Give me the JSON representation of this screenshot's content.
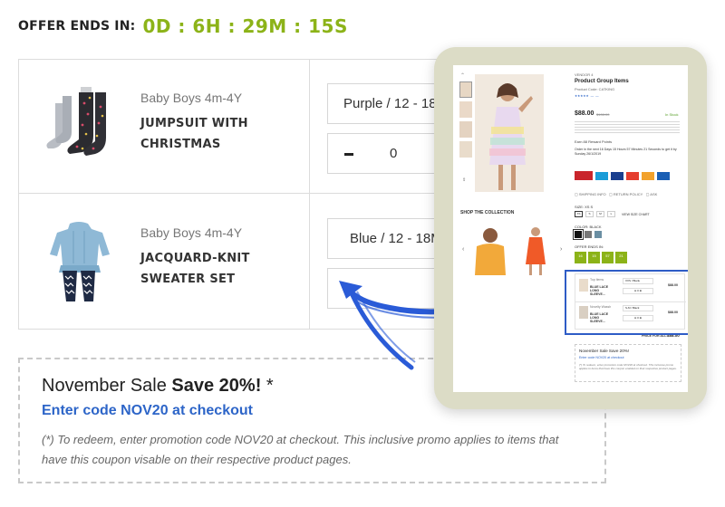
{
  "offer": {
    "label": "OFFER ENDS IN:",
    "timer": "0D : 6H : 29M : 15S"
  },
  "products": [
    {
      "category": "Baby Boys 4m-4Y",
      "title": "JUMPSUIT WITH\nCHRISTMAS",
      "variant": "Purple / 12 - 18",
      "quantity": "0"
    },
    {
      "category": "Baby Boys 4m-4Y",
      "title": "JACQUARD-KNIT\nSWEATER SET",
      "variant": "Blue / 12 - 18M",
      "quantity": ""
    }
  ],
  "sale": {
    "heading_plain": "November Sale ",
    "heading_bold": "Save 20%!",
    "heading_suffix": " *",
    "code_text": "Enter code NOV20 at checkout",
    "note": "(*) To redeem, enter promotion code NOV20 at checkout. This inclusive promo applies to items that have this coupon visable on their respective product pages."
  },
  "preview": {
    "vendor": "VENDOR 4",
    "title": "Product Group Items",
    "product_code": "Product Code: CATKING",
    "price": "$88.00",
    "old_price": "$108.00",
    "stock": "In Stock",
    "add_rewards": "Earn 88 Reward Points",
    "order_note": "Order in the next 16 Days 15 Hours 57 Minutes 21 Seconds to get it by Sunday 26/1/2019",
    "shop_collection": "SHOP THE COLLECTION",
    "size_label": "SIZE: XS S",
    "sizes": [
      "XS",
      "S",
      "M",
      "L"
    ],
    "size_chart": "VIEW SIZE CHART",
    "color_label": "COLOR: BLACK",
    "offer_label": "OFFER ENDS IN:",
    "offer_boxes": [
      "16",
      "15",
      "57",
      "21"
    ],
    "mini_items": [
      {
        "tag": "Top Items",
        "name": "BLUE LACE LONG SLEEVE...",
        "variant": "XXS / Blank",
        "price": "$88.00"
      },
      {
        "tag": "Novelty Wassh",
        "name": "BLUE LACE LONG SLEEVE...",
        "variant": "S-M / Black",
        "price": "$88.00"
      }
    ],
    "total_label": "PRICE FOR ALL:",
    "total": "$88.00",
    "mini_sale_head": "November Sale Save 20%!",
    "mini_sale_code": "Enter code NOV20 at checkout",
    "mini_sale_note": "(*) To redeem, enter promotion code NOV20 at checkout. This inclusive promo applies to items that have this coupon enabled on their respective product pages."
  },
  "colors": {
    "accent_green": "#8cb318",
    "link_blue": "#2d65c8",
    "highlight_blue": "#2e5cc6",
    "arrow_blue": "#2a5bd7"
  }
}
